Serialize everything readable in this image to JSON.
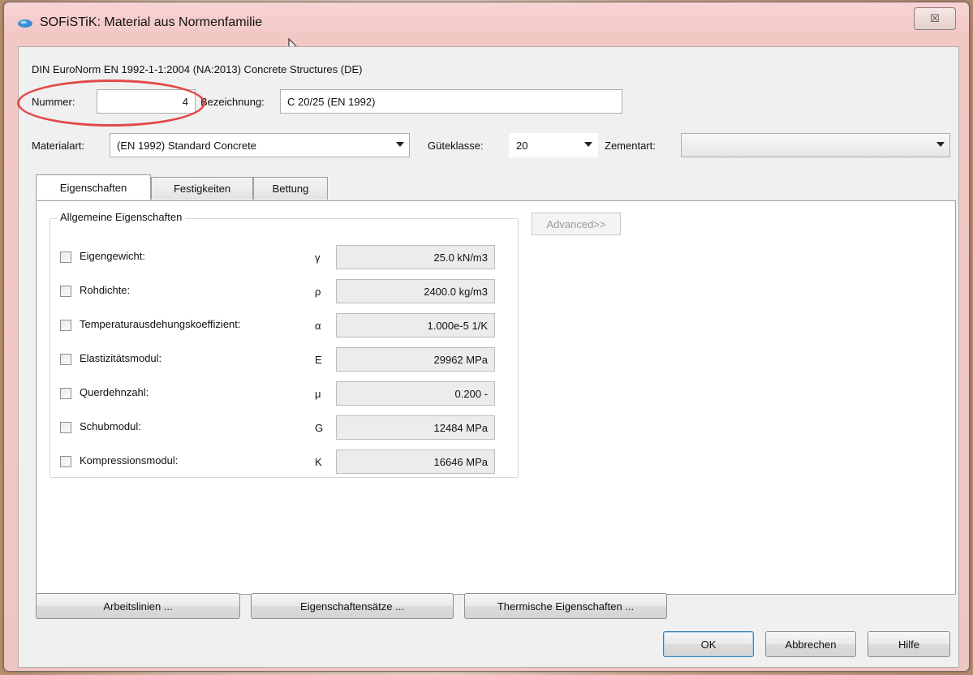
{
  "window": {
    "title": "SOFiSTiK: Material aus Normenfamilie",
    "close_glyph": "☒"
  },
  "header": {
    "norm": "DIN EuroNorm EN 1992-1-1:2004 (NA:2013) Concrete Structures (DE)",
    "nummer_label": "Nummer:",
    "nummer_value": "4",
    "bezeichnung_label": "Bezeichnung:",
    "bezeichnung_value": "C 20/25 (EN 1992)",
    "materialart_label": "Materialart:",
    "materialart_value": "(EN 1992) Standard Concrete",
    "gueteklasse_label": "Güteklasse:",
    "gueteklasse_value": "20",
    "zementart_label": "Zementart:",
    "zementart_value": ""
  },
  "tabs": [
    {
      "label": "Eigenschaften",
      "active": true
    },
    {
      "label": "Festigkeiten",
      "active": false
    },
    {
      "label": "Bettung",
      "active": false
    }
  ],
  "group": {
    "title": "Allgemeine Eigenschaften",
    "advanced_label": "Advanced>>",
    "rows": [
      {
        "label": "Eigengewicht:",
        "symbol": "γ",
        "value": "25.0 kN/m3"
      },
      {
        "label": "Rohdichte:",
        "symbol": "ρ",
        "value": "2400.0 kg/m3"
      },
      {
        "label": "Temperaturausdehungskoeffizient:",
        "symbol": "α",
        "value": "1.000e-5 1/K"
      },
      {
        "label": "Elastizitätsmodul:",
        "symbol": "E",
        "value": "29962 MPa"
      },
      {
        "label": "Querdehnzahl:",
        "symbol": "μ",
        "value": "0.200 -"
      },
      {
        "label": "Schubmodul:",
        "symbol": "G",
        "value": "12484 MPa"
      },
      {
        "label": "Kompressionsmodul:",
        "symbol": "K",
        "value": "16646 MPa"
      }
    ]
  },
  "buttons": {
    "arbeitslinien": "Arbeitslinien ...",
    "eigenschaftssaetze": "Eigenschaftensätze ...",
    "thermisch": "Thermische Eigenschaften ...",
    "ok": "OK",
    "abbrechen": "Abbrechen",
    "hilfe": "Hilfe"
  },
  "colors": {
    "highlight": "#e24a4a",
    "default_button_border": "#3c7fb1"
  }
}
